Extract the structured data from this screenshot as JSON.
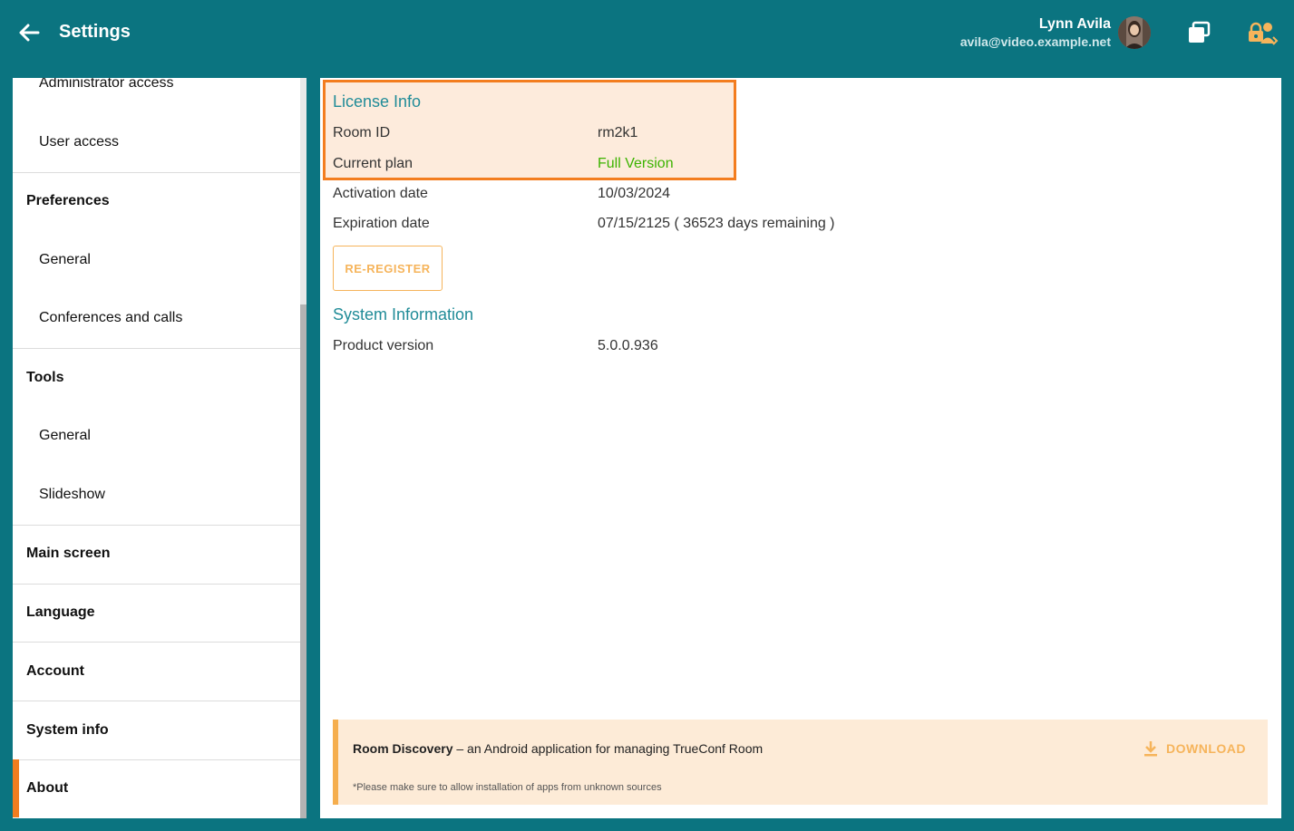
{
  "header": {
    "title": "Settings",
    "user_name": "Lynn Avila",
    "user_email": "avila@video.example.net",
    "icons": [
      "arrow-left-icon",
      "avatar",
      "windows-icon",
      "lock-user-icon"
    ]
  },
  "sidebar": {
    "items": [
      {
        "label": "Administrator access",
        "kind": "sub"
      },
      {
        "label": "User access",
        "kind": "sub"
      },
      {
        "label": "Preferences",
        "kind": "head"
      },
      {
        "label": "General",
        "kind": "sub"
      },
      {
        "label": "Conferences and calls",
        "kind": "sub"
      },
      {
        "label": "Tools",
        "kind": "head"
      },
      {
        "label": "General",
        "kind": "sub"
      },
      {
        "label": "Slideshow",
        "kind": "sub"
      },
      {
        "label": "Main screen",
        "kind": "head"
      },
      {
        "label": "Language",
        "kind": "head"
      },
      {
        "label": "Account",
        "kind": "head"
      },
      {
        "label": "System info",
        "kind": "head"
      },
      {
        "label": "About",
        "kind": "head",
        "active": true
      }
    ]
  },
  "license": {
    "title": "License Info",
    "rows": [
      {
        "label": "Room ID",
        "value": "rm2k1"
      },
      {
        "label": "Current plan",
        "value": "Full Version"
      },
      {
        "label": "Activation date",
        "value": "10/03/2024"
      },
      {
        "label": "Expiration date",
        "value": "07/15/2125 ( 36523 days remaining )"
      }
    ],
    "reregister_label": "RE-REGISTER"
  },
  "system": {
    "title": "System Information",
    "rows": [
      {
        "label": "Product version",
        "value": "5.0.0.936"
      }
    ]
  },
  "banner": {
    "app_name": "Room Discovery",
    "description": " – an Android application for managing TrueConf Room",
    "note": "*Please make sure to allow installation of apps from unknown sources",
    "download_label": "DOWNLOAD"
  },
  "colors": {
    "header_bg": "#0b7480",
    "accent_orange": "#f37d1f",
    "button_orange": "#f6b45b",
    "section_title": "#218c98",
    "plan_green": "#3cb300",
    "highlight_bg": "#fdebdc"
  }
}
